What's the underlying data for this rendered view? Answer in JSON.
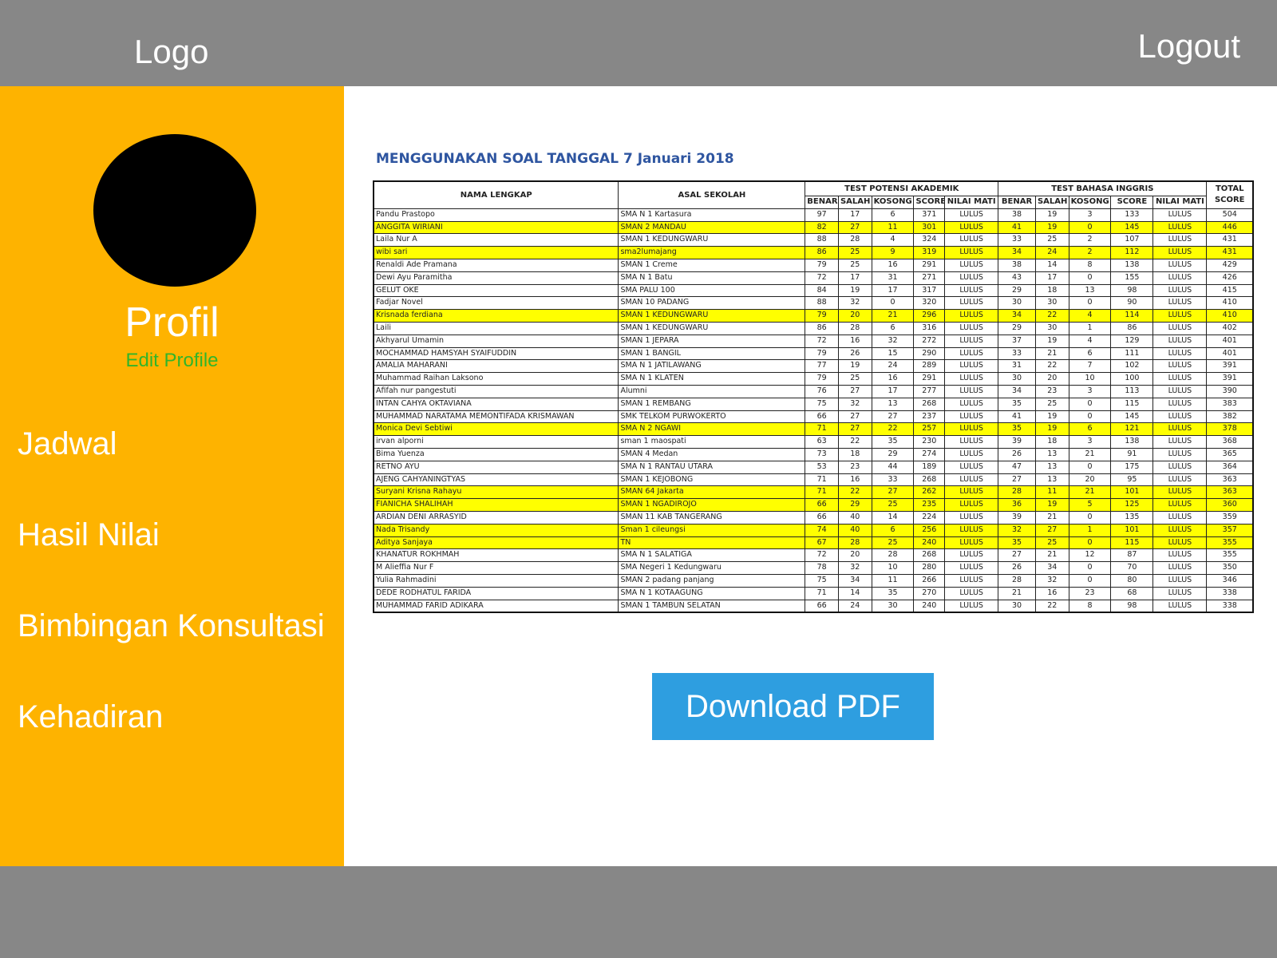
{
  "header": {
    "logo": "Logo",
    "logout": "Logout"
  },
  "sidebar": {
    "profile_title": "Profil",
    "edit_profile": "Edit  Profile",
    "items": [
      {
        "label": "Jadwal"
      },
      {
        "label": "Hasil  Nilai"
      },
      {
        "label": "Bimbingan  Konsultasi"
      },
      {
        "label": "Kehadiran"
      }
    ]
  },
  "main": {
    "sheet_title": "MENGGUNAKAN SOAL TANGGAL 7 Januari 2018",
    "download_label": "Download  PDF",
    "table": {
      "col_name": "NAMA LENGKAP",
      "col_school": "ASAL SEKOLAH",
      "group_tpa": "TEST POTENSI AKADEMIK",
      "group_english": "TEST BAHASA INGGRIS",
      "col_total": "TOTAL SCORE",
      "sub_headers": [
        "BENAR",
        "SALAH",
        "KOSONG",
        "SCORE",
        "NILAI MATI",
        "BENAR",
        "SALAH",
        "KOSONG",
        "SCORE",
        "NILAI MATI"
      ],
      "highlight_color": "#ffff00",
      "rows": [
        {
          "hl": false,
          "cells": [
            "Pandu Prastopo",
            "SMA N 1 Kartasura",
            "97",
            "17",
            "6",
            "371",
            "LULUS",
            "38",
            "19",
            "3",
            "133",
            "LULUS",
            "504"
          ]
        },
        {
          "hl": true,
          "cells": [
            "ANGGITA WIRIANI",
            "SMAN 2 MANDAU",
            "82",
            "27",
            "11",
            "301",
            "LULUS",
            "41",
            "19",
            "0",
            "145",
            "LULUS",
            "446"
          ]
        },
        {
          "hl": false,
          "cells": [
            "Laila Nur A",
            "SMAN 1 KEDUNGWARU",
            "88",
            "28",
            "4",
            "324",
            "LULUS",
            "33",
            "25",
            "2",
            "107",
            "LULUS",
            "431"
          ]
        },
        {
          "hl": true,
          "cells": [
            "wibi sari",
            "sma2lumajang",
            "86",
            "25",
            "9",
            "319",
            "LULUS",
            "34",
            "24",
            "2",
            "112",
            "LULUS",
            "431"
          ]
        },
        {
          "hl": false,
          "cells": [
            "Renaldi Ade Pramana",
            "SMAN 1 Creme",
            "79",
            "25",
            "16",
            "291",
            "LULUS",
            "38",
            "14",
            "8",
            "138",
            "LULUS",
            "429"
          ]
        },
        {
          "hl": false,
          "cells": [
            "Dewi Ayu Paramitha",
            "SMA N 1 Batu",
            "72",
            "17",
            "31",
            "271",
            "LULUS",
            "43",
            "17",
            "0",
            "155",
            "LULUS",
            "426"
          ]
        },
        {
          "hl": false,
          "cells": [
            "GELUT OKE",
            "SMA PALU 100",
            "84",
            "19",
            "17",
            "317",
            "LULUS",
            "29",
            "18",
            "13",
            "98",
            "LULUS",
            "415"
          ]
        },
        {
          "hl": false,
          "cells": [
            "Fadjar Novel",
            "SMAN 10 PADANG",
            "88",
            "32",
            "0",
            "320",
            "LULUS",
            "30",
            "30",
            "0",
            "90",
            "LULUS",
            "410"
          ]
        },
        {
          "hl": true,
          "cells": [
            "Krisnada ferdiana",
            "SMAN 1 KEDUNGWARU",
            "79",
            "20",
            "21",
            "296",
            "LULUS",
            "34",
            "22",
            "4",
            "114",
            "LULUS",
            "410"
          ]
        },
        {
          "hl": false,
          "cells": [
            "Laili",
            "SMAN 1 KEDUNGWARU",
            "86",
            "28",
            "6",
            "316",
            "LULUS",
            "29",
            "30",
            "1",
            "86",
            "LULUS",
            "402"
          ]
        },
        {
          "hl": false,
          "cells": [
            "Akhyarul Umamin",
            "SMAN 1 JEPARA",
            "72",
            "16",
            "32",
            "272",
            "LULUS",
            "37",
            "19",
            "4",
            "129",
            "LULUS",
            "401"
          ]
        },
        {
          "hl": false,
          "cells": [
            "MOCHAMMAD HAMSYAH SYAIFUDDIN",
            "SMAN 1 BANGIL",
            "79",
            "26",
            "15",
            "290",
            "LULUS",
            "33",
            "21",
            "6",
            "111",
            "LULUS",
            "401"
          ]
        },
        {
          "hl": false,
          "cells": [
            "AMALIA MAHARANI",
            "SMA N 1 JATILAWANG",
            "77",
            "19",
            "24",
            "289",
            "LULUS",
            "31",
            "22",
            "7",
            "102",
            "LULUS",
            "391"
          ]
        },
        {
          "hl": false,
          "cells": [
            "Muhammad Raihan Laksono",
            "SMA N 1 KLATEN",
            "79",
            "25",
            "16",
            "291",
            "LULUS",
            "30",
            "20",
            "10",
            "100",
            "LULUS",
            "391"
          ]
        },
        {
          "hl": false,
          "cells": [
            "Afifah nur pangestuti",
            "Alumni",
            "76",
            "27",
            "17",
            "277",
            "LULUS",
            "34",
            "23",
            "3",
            "113",
            "LULUS",
            "390"
          ]
        },
        {
          "hl": false,
          "cells": [
            "INTAN CAHYA OKTAVIANA",
            "SMAN 1 REMBANG",
            "75",
            "32",
            "13",
            "268",
            "LULUS",
            "35",
            "25",
            "0",
            "115",
            "LULUS",
            "383"
          ]
        },
        {
          "hl": false,
          "cells": [
            "MUHAMMAD NARATAMA MEMONTIFADA KRISMAWAN",
            "SMK TELKOM PURWOKERTO",
            "66",
            "27",
            "27",
            "237",
            "LULUS",
            "41",
            "19",
            "0",
            "145",
            "LULUS",
            "382"
          ]
        },
        {
          "hl": true,
          "cells": [
            "Monica Devi Sebtiwi",
            "SMA N 2 NGAWI",
            "71",
            "27",
            "22",
            "257",
            "LULUS",
            "35",
            "19",
            "6",
            "121",
            "LULUS",
            "378"
          ]
        },
        {
          "hl": false,
          "cells": [
            "irvan alporni",
            "sman 1 maospati",
            "63",
            "22",
            "35",
            "230",
            "LULUS",
            "39",
            "18",
            "3",
            "138",
            "LULUS",
            "368"
          ]
        },
        {
          "hl": false,
          "cells": [
            "Bima Yuenza",
            "SMAN 4 Medan",
            "73",
            "18",
            "29",
            "274",
            "LULUS",
            "26",
            "13",
            "21",
            "91",
            "LULUS",
            "365"
          ]
        },
        {
          "hl": false,
          "cells": [
            "RETNO AYU",
            "SMA N 1 RANTAU UTARA",
            "53",
            "23",
            "44",
            "189",
            "LULUS",
            "47",
            "13",
            "0",
            "175",
            "LULUS",
            "364"
          ]
        },
        {
          "hl": false,
          "cells": [
            "AJENG CAHYANINGTYAS",
            "SMAN 1 KEJOBONG",
            "71",
            "16",
            "33",
            "268",
            "LULUS",
            "27",
            "13",
            "20",
            "95",
            "LULUS",
            "363"
          ]
        },
        {
          "hl": true,
          "cells": [
            "Suryani Krisna Rahayu",
            "SMAN 64 Jakarta",
            "71",
            "22",
            "27",
            "262",
            "LULUS",
            "28",
            "11",
            "21",
            "101",
            "LULUS",
            "363"
          ]
        },
        {
          "hl": true,
          "cells": [
            "FIANICHA SHALIHAH",
            "SMAN 1 NGADIROJO",
            "66",
            "29",
            "25",
            "235",
            "LULUS",
            "36",
            "19",
            "5",
            "125",
            "LULUS",
            "360"
          ]
        },
        {
          "hl": false,
          "cells": [
            "ARDIAN DENI ARRASYID",
            "SMAN 11 KAB TANGERANG",
            "66",
            "40",
            "14",
            "224",
            "LULUS",
            "39",
            "21",
            "0",
            "135",
            "LULUS",
            "359"
          ]
        },
        {
          "hl": true,
          "cells": [
            "Nada Trisandy",
            "Sman 1 cileungsi",
            "74",
            "40",
            "6",
            "256",
            "LULUS",
            "32",
            "27",
            "1",
            "101",
            "LULUS",
            "357"
          ]
        },
        {
          "hl": true,
          "cells": [
            "Aditya Sanjaya",
            "TN",
            "67",
            "28",
            "25",
            "240",
            "LULUS",
            "35",
            "25",
            "0",
            "115",
            "LULUS",
            "355"
          ]
        },
        {
          "hl": false,
          "cells": [
            "KHANATUR ROKHMAH",
            "SMA N 1 SALATIGA",
            "72",
            "20",
            "28",
            "268",
            "LULUS",
            "27",
            "21",
            "12",
            "87",
            "LULUS",
            "355"
          ]
        },
        {
          "hl": false,
          "cells": [
            "M Alieffia Nur F",
            "SMA Negeri 1 Kedungwaru",
            "78",
            "32",
            "10",
            "280",
            "LULUS",
            "26",
            "34",
            "0",
            "70",
            "LULUS",
            "350"
          ]
        },
        {
          "hl": false,
          "cells": [
            "Yulia Rahmadini",
            "SMAN 2 padang panjang",
            "75",
            "34",
            "11",
            "266",
            "LULUS",
            "28",
            "32",
            "0",
            "80",
            "LULUS",
            "346"
          ]
        },
        {
          "hl": false,
          "cells": [
            "DEDE RODHATUL FARIDA",
            "SMA N 1 KOTAAGUNG",
            "71",
            "14",
            "35",
            "270",
            "LULUS",
            "21",
            "16",
            "23",
            "68",
            "LULUS",
            "338"
          ]
        },
        {
          "hl": false,
          "cells": [
            "MUHAMMAD FARID ADIKARA",
            "SMAN 1 TAMBUN SELATAN",
            "66",
            "24",
            "30",
            "240",
            "LULUS",
            "30",
            "22",
            "8",
            "98",
            "LULUS",
            "338"
          ]
        }
      ]
    }
  },
  "colors": {
    "header_bg": "#878787",
    "sidebar_bg": "#feb300",
    "button_bg": "#2e9ee0",
    "edit_profile": "#31b52a",
    "title": "#2e55a0"
  },
  "icons": {
    "avatar": "avatar-placeholder-circle"
  }
}
